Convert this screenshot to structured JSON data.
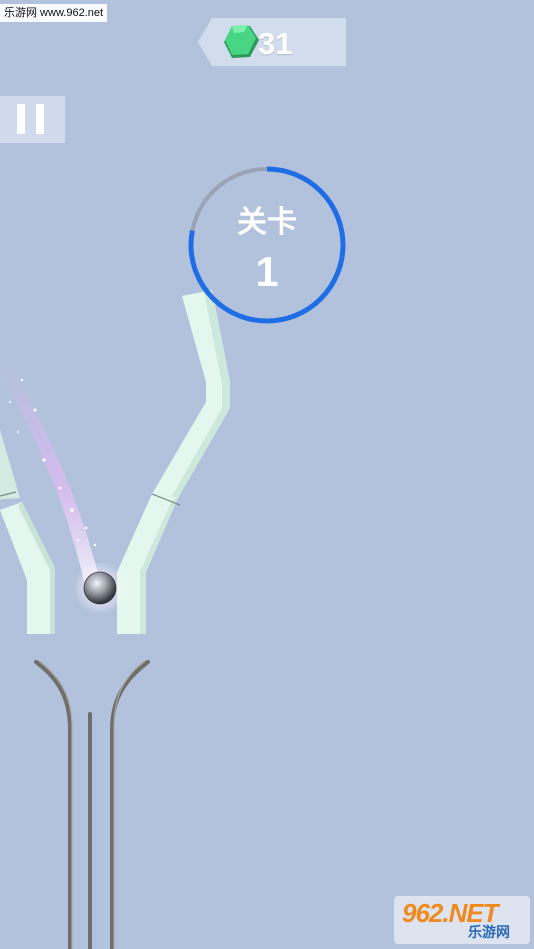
{
  "watermark": {
    "top_text": "乐游网 www.962.net",
    "logo_main": "962.NET",
    "logo_sub": "乐游网"
  },
  "hud": {
    "gem_count": "31",
    "gem_icon": "hexagon-gem-icon",
    "level_label": "关卡",
    "level_number": "1",
    "level_progress": 0.78,
    "pause_icon": "pause-icon"
  },
  "colors": {
    "background": "#b3c2dc",
    "track": "#e4f7ee",
    "progress_ring": "#1f6ee6",
    "progress_track": "#9aa3b4",
    "gem": "#3ccf7a",
    "ball": "#8a8f99",
    "rail": "#6e6e6a",
    "trail": "#f0a8ff"
  }
}
